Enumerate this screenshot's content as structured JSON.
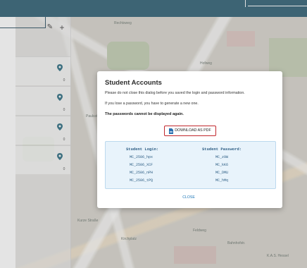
{
  "map": {
    "labels": [
      "Rechtsweg",
      "Hofweg",
      "Paulsstraße",
      "Kurze Straße",
      "Kirchplatz",
      "Feldweg",
      "Bahnhofstr.",
      "K.A.S. Hessel"
    ]
  },
  "sidebar": {
    "toolbar_icons": [
      "edit-icon",
      "plus-icon"
    ],
    "items": [
      {
        "count": "0"
      },
      {
        "count": "0"
      },
      {
        "count": "0"
      },
      {
        "count": "0"
      }
    ],
    "pin_color": "#2f6f82"
  },
  "dialog": {
    "title": "Student Accounts",
    "line1": "Please do not close this dialog before you saved the login and password information.",
    "line2": "If you lose a password, you have to generate a new one.",
    "warning": "The passwords cannot be displayed again.",
    "download_label": "DOWNLOAD AS PDF",
    "download_icon": "pdf-file-icon",
    "highlight_color": "#c1272d",
    "credentials": {
      "login_header": "Student Login:",
      "password_header": "Student Password:",
      "logins": [
        "MC_2506_hpx",
        "MC_2506_XCF",
        "MC_2506_nPH",
        "MC_2506_tPQ"
      ],
      "passwords": [
        "MC_z9W",
        "MC_kK6",
        "MC_DMU",
        "MC_hMq"
      ]
    },
    "close_label": "CLOSE"
  }
}
